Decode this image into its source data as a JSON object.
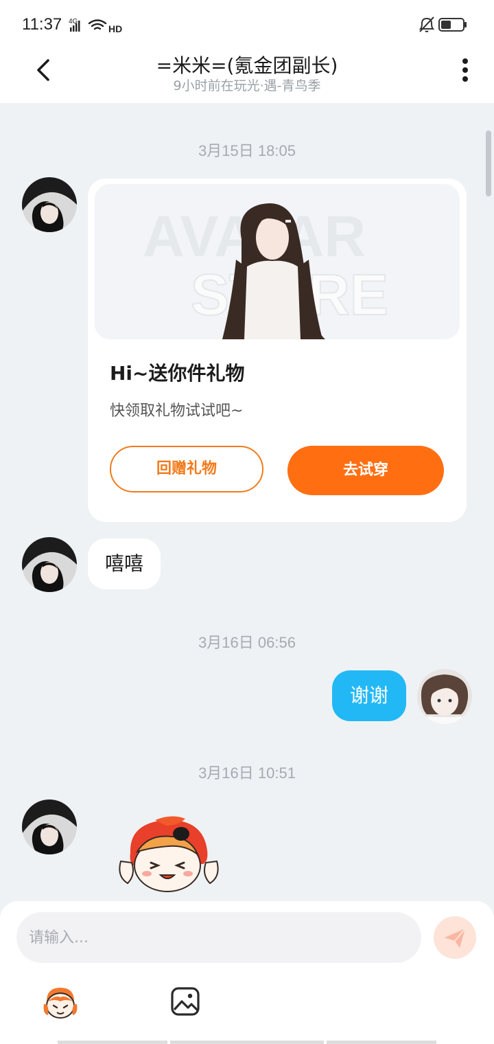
{
  "status": {
    "time": "11:37",
    "net_label": "4G",
    "hd_label": "HD"
  },
  "header": {
    "title": "=米米=(氪金团副长)",
    "subtitle": "9小时前在玩光·遇-青鸟季"
  },
  "chat": {
    "timestamps": [
      "3月15日 18:05",
      "3月16日 06:56",
      "3月16日 10:51"
    ],
    "gift_card": {
      "bg_text_top": "AVATAR",
      "bg_text_bottom": "STORE",
      "title": "Hi~送你件礼物",
      "subtitle": "快领取礼物试试吧~",
      "return_gift_label": "回赠礼物",
      "try_on_label": "去试穿"
    },
    "msg_incoming": "嘻嘻",
    "msg_outgoing": "谢谢"
  },
  "input": {
    "placeholder": "请输入..."
  },
  "colors": {
    "accent_orange": "#ff6f12",
    "bubble_blue": "#22b8f5",
    "background": "#eef2f5"
  },
  "icons": [
    "back-icon",
    "more-icon",
    "send-icon",
    "emoji-icon",
    "image-icon",
    "mute-icon",
    "battery-icon",
    "wifi-icon",
    "signal-icon"
  ]
}
